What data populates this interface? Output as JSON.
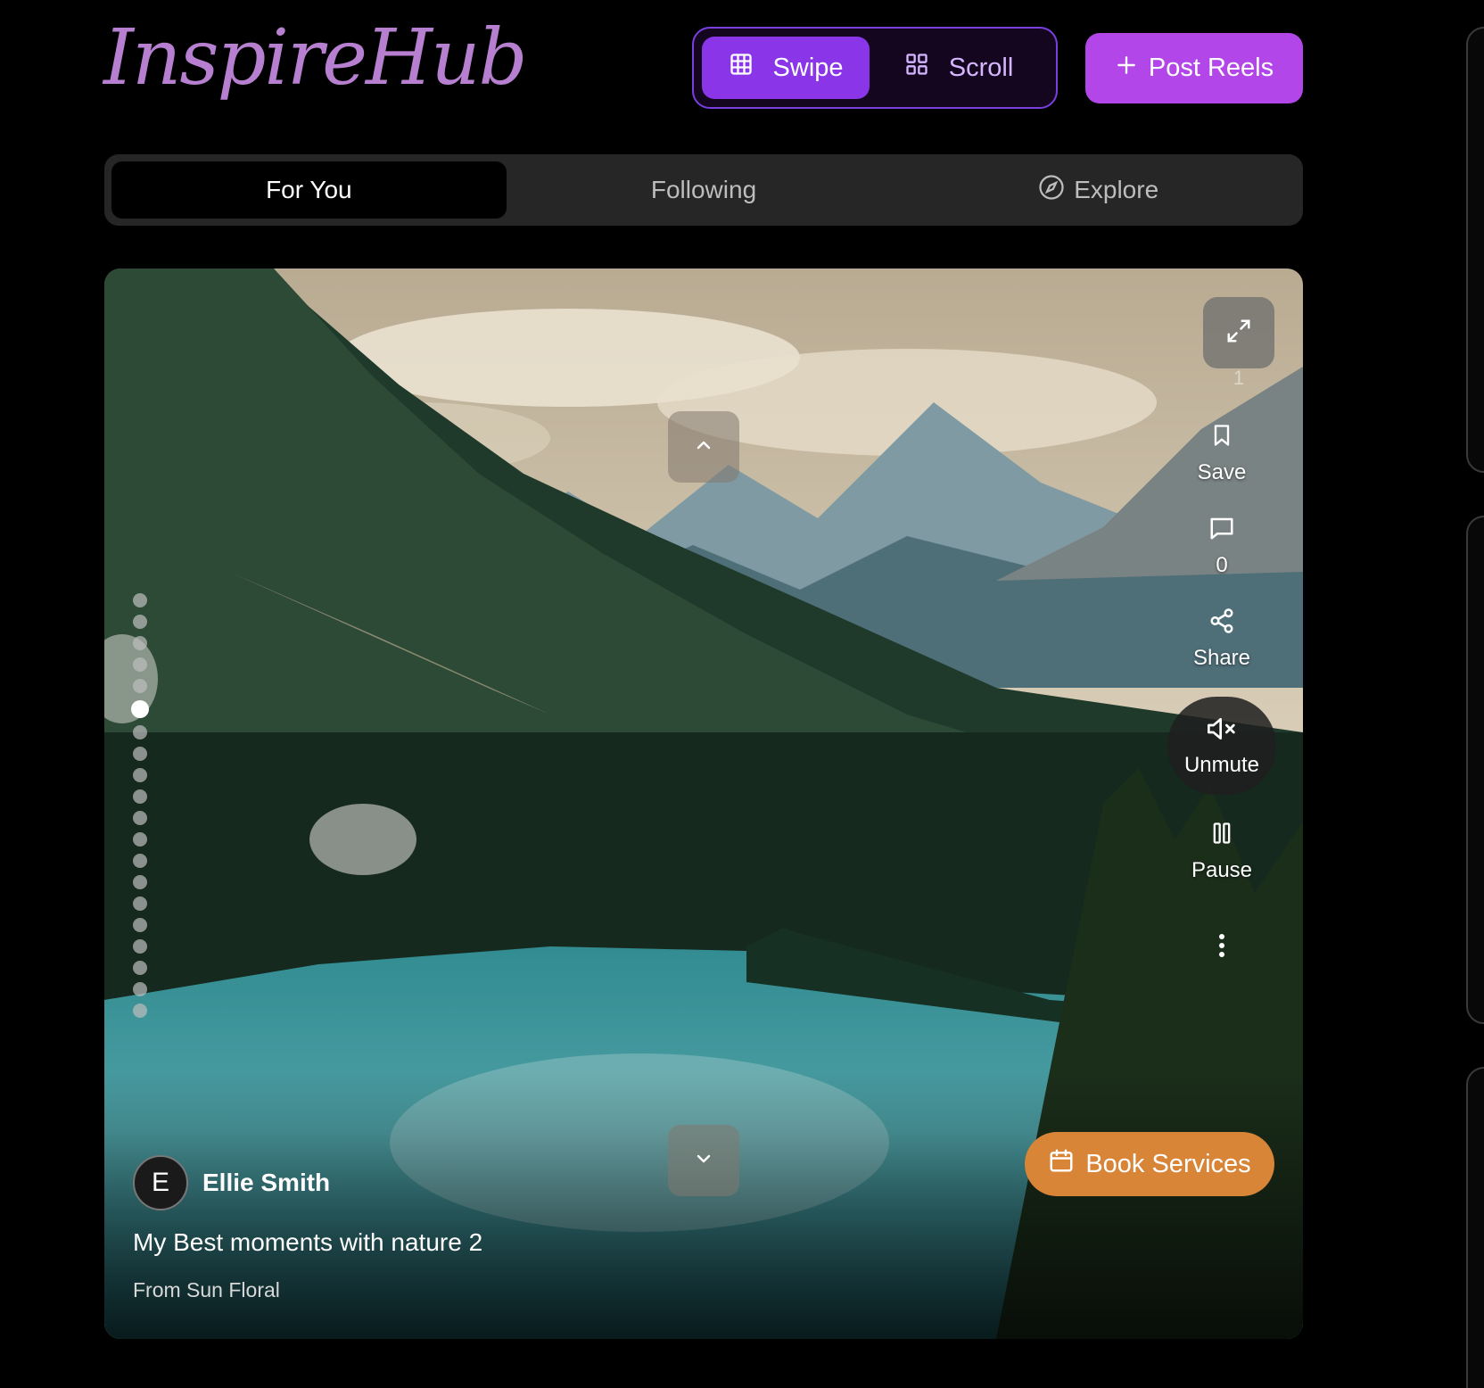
{
  "header": {
    "logo": "InspireHub",
    "view_modes": [
      {
        "label": "Swipe",
        "icon": "grid-3x3-icon",
        "active": true
      },
      {
        "label": "Scroll",
        "icon": "grid-2x2-icon",
        "active": false
      }
    ],
    "post_button": {
      "label": "Post Reels",
      "icon": "plus-icon"
    }
  },
  "tabs": [
    {
      "label": "For You",
      "active": true
    },
    {
      "label": "Following",
      "active": false
    },
    {
      "label": "Explore",
      "icon": "compass-icon",
      "active": false
    }
  ],
  "reel": {
    "author": {
      "initial": "E",
      "name": "Ellie Smith"
    },
    "caption": "My Best moments with nature 2",
    "source": "From Sun Floral",
    "book_button": {
      "label": "Book Services",
      "icon": "calendar-icon"
    },
    "actions": {
      "like_count": "1",
      "save": "Save",
      "comment_count": "0",
      "share": "Share",
      "unmute": "Unmute",
      "pause": "Pause"
    },
    "progress": {
      "total": 20,
      "active_index": 5
    }
  },
  "colors": {
    "accent_purple": "#8a35e8",
    "post_button": "#b246e8",
    "book_button": "#d98538",
    "tab_bar": "#262626"
  }
}
